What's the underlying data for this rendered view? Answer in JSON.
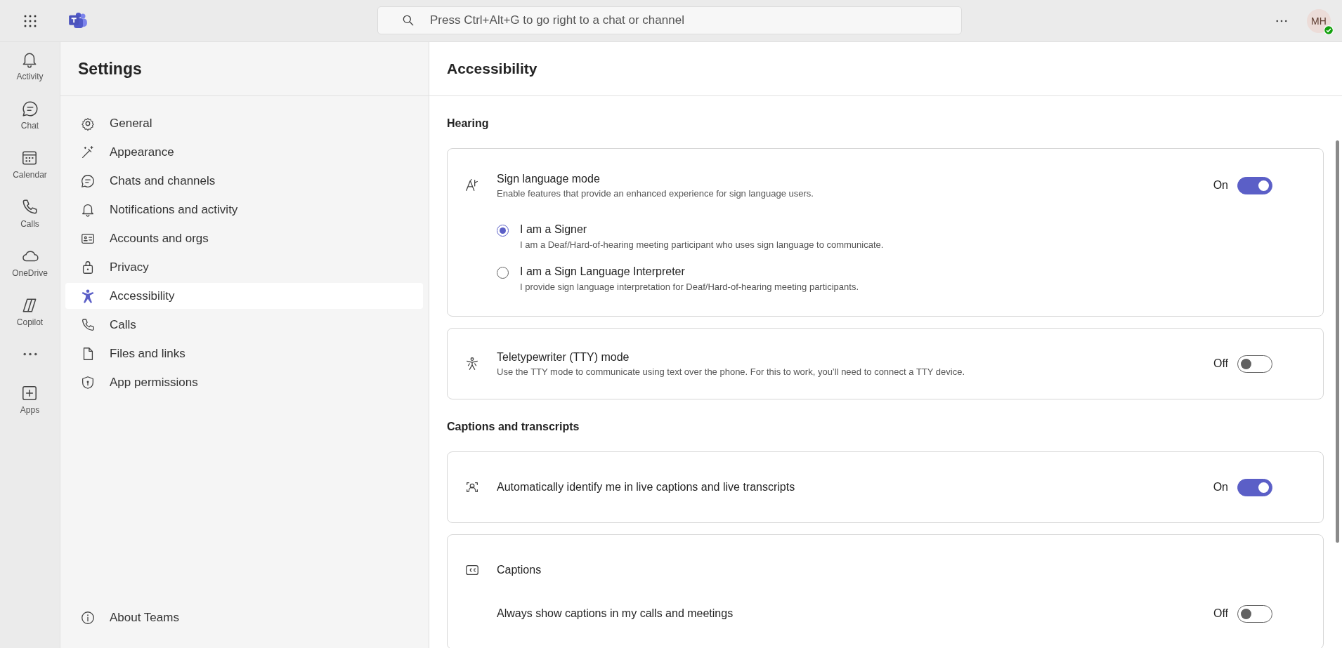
{
  "top_bar": {
    "search": {
      "placeholder": "Press Ctrl+Alt+G to go right to a chat or channel"
    },
    "avatar": {
      "initials": "MH",
      "available": true
    }
  },
  "app_rail": {
    "items": [
      {
        "label": "Activity"
      },
      {
        "label": "Chat"
      },
      {
        "label": "Calendar"
      },
      {
        "label": "Calls"
      },
      {
        "label": "OneDrive"
      },
      {
        "label": "Copilot"
      }
    ],
    "pinned": [
      {
        "label": "Apps"
      }
    ]
  },
  "settings_nav": {
    "title": "Settings",
    "items": [
      {
        "label": "General",
        "selected": false
      },
      {
        "label": "Appearance",
        "selected": false
      },
      {
        "label": "Chats and channels",
        "selected": false
      },
      {
        "label": "Notifications and activity",
        "selected": false
      },
      {
        "label": "Accounts and orgs",
        "selected": false
      },
      {
        "label": "Privacy",
        "selected": false
      },
      {
        "label": "Accessibility",
        "selected": true
      },
      {
        "label": "Calls",
        "selected": false
      },
      {
        "label": "Files and links",
        "selected": false
      },
      {
        "label": "App permissions",
        "selected": false
      }
    ],
    "footer_item": {
      "label": "About Teams"
    }
  },
  "page": {
    "title": "Accessibility",
    "sections": [
      {
        "heading": "Hearing",
        "cards": [
          {
            "title": "Sign language mode",
            "description": "Enable features that provide an enhanced experience for sign language users.",
            "toggle_label": "On",
            "on": true,
            "options": [
              {
                "label": "I am a Signer",
                "description": "I am a Deaf/Hard-of-hearing meeting participant who uses sign language to communicate.",
                "selected": true
              },
              {
                "label": "I am a Sign Language Interpreter",
                "description": "I provide sign language interpretation for Deaf/Hard-of-hearing meeting participants.",
                "selected": false
              }
            ]
          },
          {
            "title": "Teletypewriter (TTY) mode",
            "description": "Use the TTY mode to communicate using text over the phone. For this to work, you’ll need to connect a TTY device.",
            "toggle_label": "Off",
            "on": false
          }
        ]
      },
      {
        "heading": "Captions and transcripts",
        "cards": [
          {
            "title": "Automatically identify me in live captions and live transcripts",
            "toggle_label": "On",
            "on": true
          },
          {
            "title": "Captions",
            "rows": [
              {
                "label": "Always show captions in my calls and meetings",
                "toggle_label": "Off",
                "on": false
              }
            ]
          }
        ]
      }
    ]
  }
}
